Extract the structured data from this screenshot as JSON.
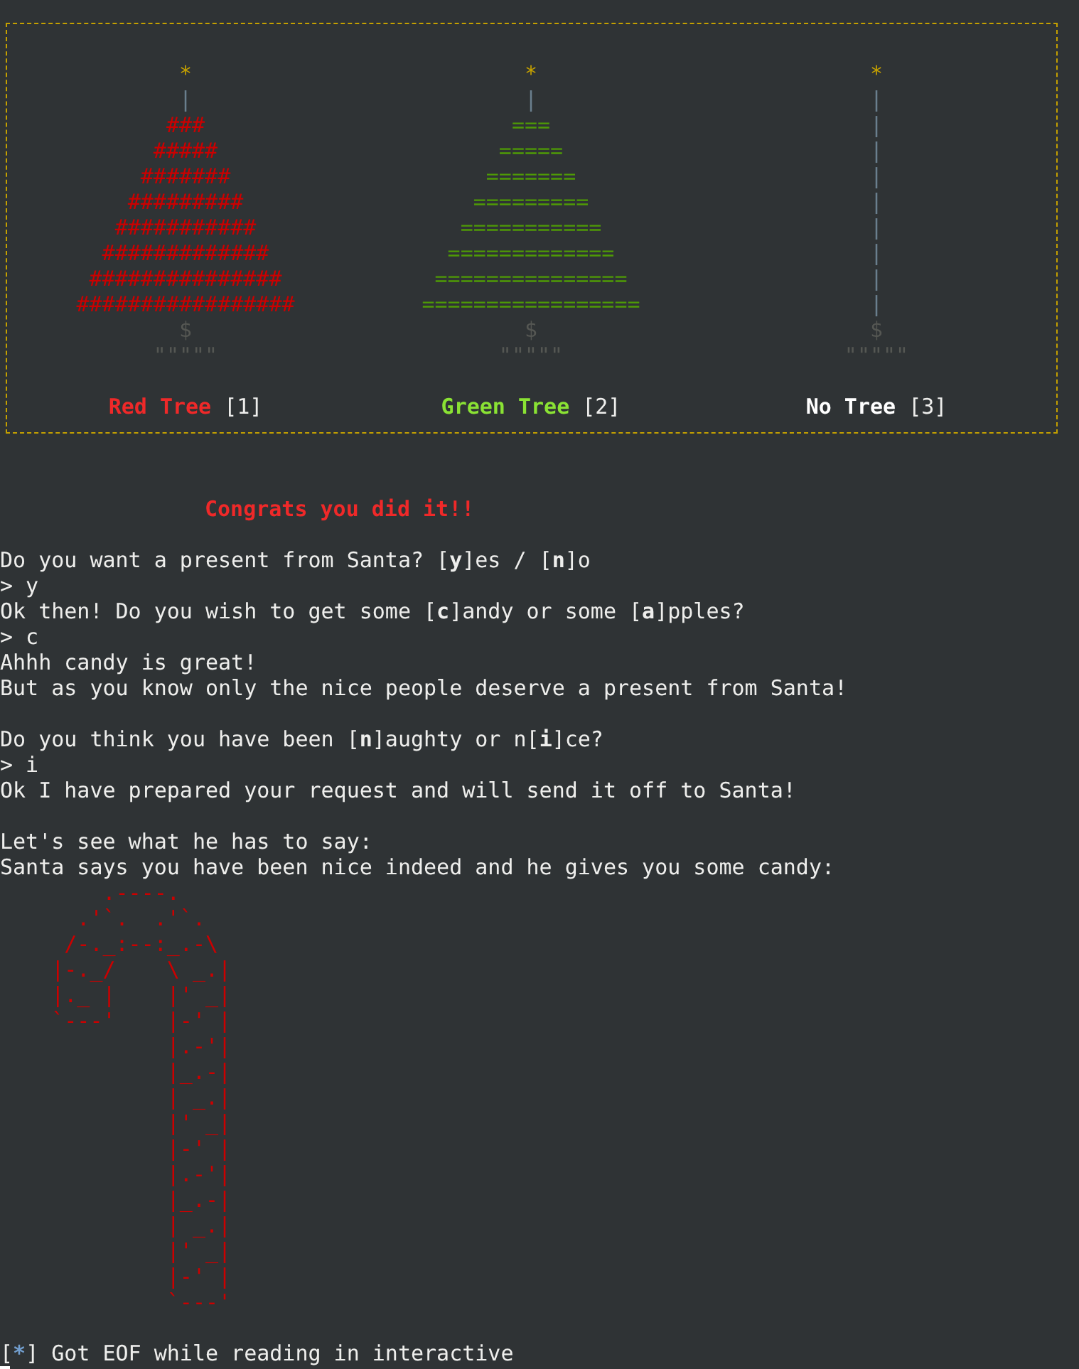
{
  "tree_panel": {
    "trees": [
      {
        "kind": "red",
        "star": "*",
        "trunk": "|",
        "rows": [
          "###",
          "#####",
          "#######",
          "#########",
          "###########",
          "#############",
          "###############",
          "#################"
        ],
        "base": "$",
        "roots": "\"\"\"\"\"",
        "label": "Red Tree",
        "key": "[1]"
      },
      {
        "kind": "green",
        "star": "*",
        "trunk": "|",
        "rows": [
          "===",
          "=====",
          "=======",
          "=========",
          "===========",
          "=============",
          "===============",
          "================="
        ],
        "base": "$",
        "roots": "\"\"\"\"\"",
        "label": "Green Tree",
        "key": "[2]"
      },
      {
        "kind": "none",
        "star": "*",
        "trunk": "|",
        "rows": [
          "|",
          "|",
          "|",
          "|",
          "|",
          "|",
          "|",
          "|"
        ],
        "base": "$",
        "roots": "\"\"\"\"\"",
        "label": "No Tree",
        "key": "[3]"
      }
    ]
  },
  "log": [
    {
      "kind": "blank"
    },
    {
      "kind": "blank"
    },
    {
      "kind": "heading",
      "text": "Congrats you did it!!"
    },
    {
      "kind": "blank"
    },
    {
      "kind": "output",
      "text": "Do you want a present from Santa? [**y**]es / [**n**]o"
    },
    {
      "kind": "input",
      "text": "> y"
    },
    {
      "kind": "output",
      "text": "Ok then! Do you wish to get some [**c**]andy or some [**a**]pples?"
    },
    {
      "kind": "input",
      "text": "> c"
    },
    {
      "kind": "output",
      "text": "Ahhh candy is great!"
    },
    {
      "kind": "output",
      "text": "But as you know only the nice people deserve a present from Santa!"
    },
    {
      "kind": "blank"
    },
    {
      "kind": "output",
      "text": "Do you think you have been [**n**]aughty or n[**i**]ce?"
    },
    {
      "kind": "input",
      "text": "> i"
    },
    {
      "kind": "output",
      "text": "Ok I have prepared your request and will send it off to Santa!"
    },
    {
      "kind": "blank"
    },
    {
      "kind": "output",
      "text": "Let's see what he has to say:"
    },
    {
      "kind": "output",
      "text": "Santa says you have been nice indeed and he gives you some candy:"
    }
  ],
  "candy_art": [
    "        .----.",
    "      .'`.  .'`.",
    "     /-._:--:_.-\\",
    "    |-._/    \\ _.|",
    "    |._ |    |' _|",
    "    `---'    |-' |",
    "             |.-'|",
    "             |_.-|",
    "             | _.|",
    "             |' _|",
    "             |-' |",
    "             |.-'|",
    "             |_.-|",
    "             | _.|",
    "             |' _|",
    "             |-' |",
    "             `---'"
  ],
  "status": {
    "open": "[",
    "mark": "*",
    "close": "]",
    "text": "Got EOF while reading in interactive"
  }
}
